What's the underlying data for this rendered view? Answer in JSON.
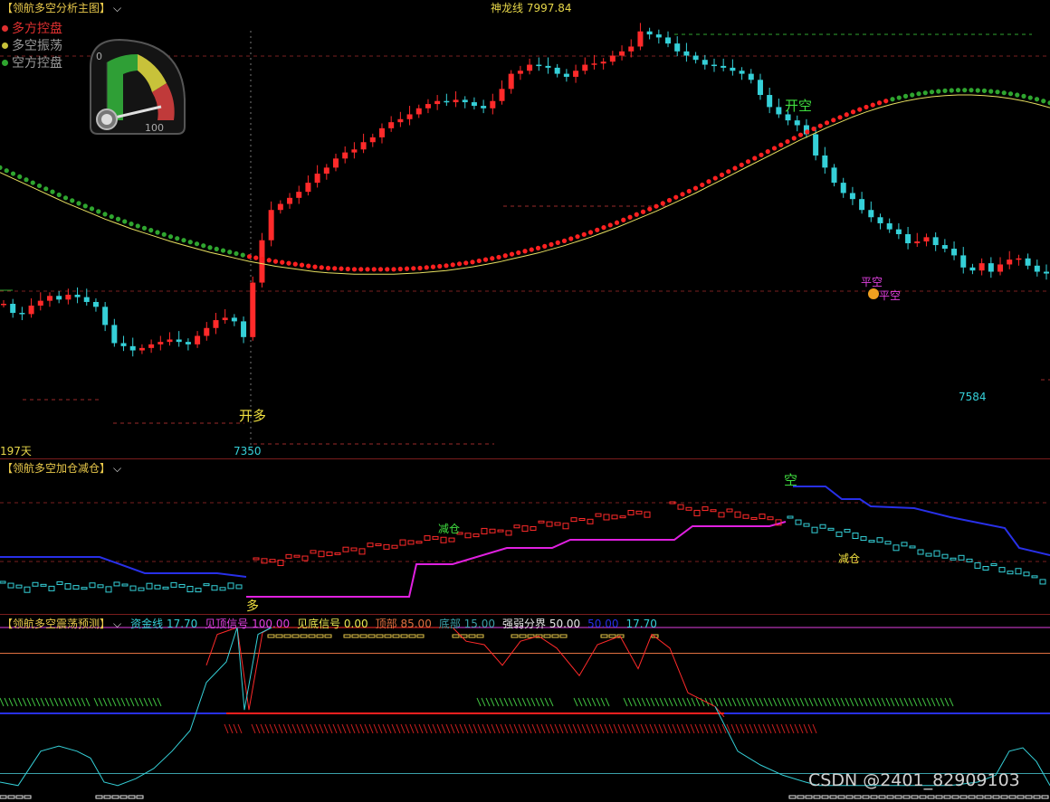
{
  "main": {
    "title": "【领航多空分析主图】",
    "shenlong_label": "神龙线",
    "shenlong_value": "7997.84",
    "legend": [
      {
        "label": "多方控盘",
        "color": "#e03030"
      },
      {
        "label": "多空振荡",
        "color": "#c8c23a"
      },
      {
        "label": "空方控盘",
        "color": "#2fa52f"
      }
    ],
    "gauge": {
      "min_label": "0",
      "max_label": "100",
      "value": 88
    },
    "days_label": "197天",
    "low_label": "7350",
    "low2_label": "7584",
    "signals": {
      "open_long": "开多",
      "open_short": "开空",
      "close_short": "平空",
      "close_short2": "平空"
    }
  },
  "sub1": {
    "title": "【领航多空加仓减仓】",
    "duo": "多",
    "kong": "空",
    "reduce1": "减仓",
    "reduce2": "减仓"
  },
  "sub2": {
    "title": "【领航多空震荡预测】",
    "items": [
      {
        "label": "资金线",
        "value": "17.70",
        "color": "#35d0d8"
      },
      {
        "label": "见顶信号",
        "value": "100.00",
        "color": "#e040e0"
      },
      {
        "label": "见底信号",
        "value": "0.00",
        "color": "#e8e850"
      },
      {
        "label": "顶部",
        "value": "85.00",
        "color": "#e07040"
      },
      {
        "label": "底部",
        "value": "15.00",
        "color": "#3aa0a8"
      },
      {
        "label": "强弱分界",
        "value": "50.00",
        "color": "#e8e8e8"
      },
      {
        "label": "",
        "value": "50.00",
        "color": "#2830e8"
      },
      {
        "label": "",
        "value": "17.70",
        "color": "#35d0d8"
      }
    ]
  },
  "watermark": "CSDN @2401_82909103",
  "chart_data": [
    {
      "type": "candlestick",
      "title": "领航多空分析主图",
      "y_range": [
        7300,
        8020
      ],
      "closes": [
        7545,
        7530,
        7528,
        7542,
        7550,
        7558,
        7552,
        7560,
        7556,
        7548,
        7540,
        7510,
        7480,
        7475,
        7468,
        7472,
        7478,
        7482,
        7486,
        7482,
        7478,
        7492,
        7505,
        7518,
        7522,
        7516,
        7490,
        7580,
        7650,
        7700,
        7710,
        7720,
        7730,
        7745,
        7760,
        7770,
        7785,
        7795,
        7800,
        7812,
        7820,
        7835,
        7845,
        7850,
        7858,
        7868,
        7875,
        7880,
        7878,
        7882,
        7878,
        7872,
        7868,
        7880,
        7900,
        7925,
        7930,
        7940,
        7938,
        7935,
        7925,
        7920,
        7930,
        7940,
        7942,
        7945,
        7955,
        7962,
        7970,
        7995,
        7990,
        7985,
        7975,
        7962,
        7955,
        7948,
        7940,
        7938,
        7935,
        7930,
        7925,
        7915,
        7890,
        7870,
        7858,
        7848,
        7840,
        7825,
        7790,
        7770,
        7745,
        7728,
        7718,
        7700,
        7688,
        7678,
        7668,
        7660,
        7645,
        7648,
        7655,
        7642,
        7636,
        7625,
        7605,
        7600,
        7612,
        7598,
        7610,
        7618,
        7620,
        7608,
        7598,
        7595
      ],
      "ma_dots": [
        7770,
        7760,
        7750,
        7740,
        7730,
        7720,
        7711,
        7702,
        7693,
        7685,
        7677,
        7670,
        7663,
        7656,
        7650,
        7644,
        7638,
        7633,
        7628,
        7623,
        7619,
        7615,
        7612,
        7609,
        7606,
        7604,
        7603,
        7602,
        7602,
        7602,
        7602,
        7603,
        7604,
        7606,
        7608,
        7611,
        7614,
        7618,
        7622,
        7627,
        7632,
        7637,
        7643,
        7649,
        7656,
        7663,
        7671,
        7679,
        7688,
        7697,
        7706,
        7716,
        7726,
        7736,
        7747,
        7758,
        7769,
        7780,
        7791,
        7802,
        7813,
        7824,
        7834,
        7844,
        7853,
        7862,
        7870,
        7877,
        7883,
        7888,
        7892,
        7895,
        7897,
        7898,
        7898,
        7897,
        7895,
        7892,
        7888,
        7883,
        7877
      ]
    },
    {
      "type": "line",
      "title": "领航多空加仓减仓"
    },
    {
      "type": "line",
      "title": "领航多空震荡预测",
      "series": [
        {
          "name": "资金线",
          "last": 17.7
        },
        {
          "name": "见顶信号",
          "last": 100.0
        },
        {
          "name": "见底信号",
          "last": 0.0
        },
        {
          "name": "顶部",
          "last": 85.0
        },
        {
          "name": "底部",
          "last": 15.0
        },
        {
          "name": "强弱分界",
          "last": 50.0
        }
      ],
      "y_range": [
        0,
        100
      ]
    }
  ]
}
